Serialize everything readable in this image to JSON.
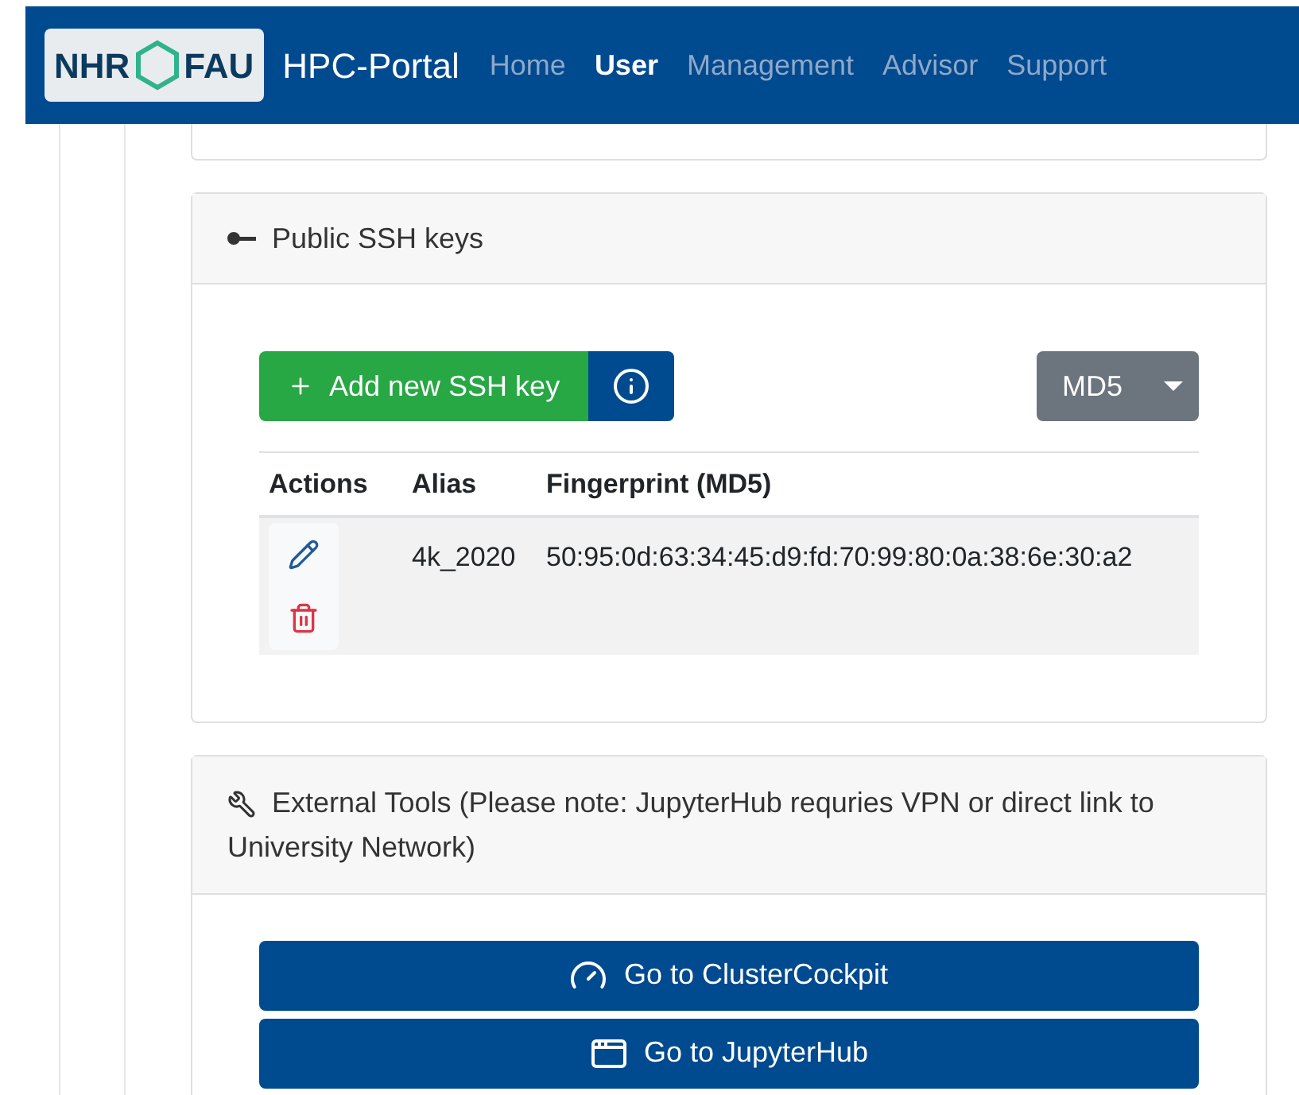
{
  "navbar": {
    "logo": {
      "left": "NHR",
      "right": "FAU"
    },
    "title": "HPC-Portal",
    "items": [
      {
        "label": "Home",
        "selected": false
      },
      {
        "label": "User",
        "selected": true
      },
      {
        "label": "Management",
        "selected": false
      },
      {
        "label": "Advisor",
        "selected": false
      },
      {
        "label": "Support",
        "selected": false
      }
    ]
  },
  "ssh_keys": {
    "title": "Public SSH keys",
    "add_button": "Add new SSH key",
    "hash_select": {
      "value": "MD5"
    },
    "table": {
      "columns": [
        "Actions",
        "Alias",
        "Fingerprint (MD5)"
      ],
      "rows": [
        {
          "alias": "4k_2020",
          "fingerprint": "50:95:0d:63:34:45:d9:fd:70:99:80:0a:38:6e:30:a2"
        }
      ]
    }
  },
  "external_tools": {
    "title": "External Tools (Please note: JupyterHub requries VPN or direct link to University Network)",
    "buttons": [
      {
        "label": "Go to ClusterCockpit",
        "kind": "gauge"
      },
      {
        "label": "Go to JupyterHub",
        "kind": "window"
      }
    ]
  }
}
